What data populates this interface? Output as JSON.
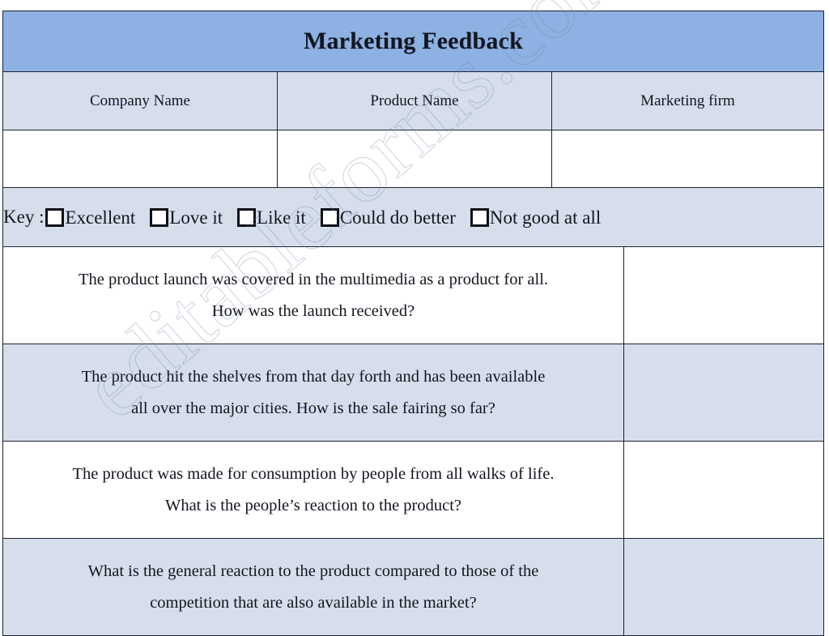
{
  "document": {
    "title": "Marketing Feedback",
    "watermark": "editableforms.com"
  },
  "colors": {
    "title_bar": "#8db1e3",
    "shaded_row": "#d6deec",
    "plain_row": "#ffffff",
    "border": "#1c2230",
    "text": "#12161f"
  },
  "info_table": {
    "headers": [
      "Company Name",
      "Product Name",
      "Marketing firm"
    ],
    "values": [
      "",
      "",
      ""
    ]
  },
  "key": {
    "label": "Key :",
    "options": [
      {
        "label": "Excellent",
        "checked": false
      },
      {
        "label": "Love it",
        "checked": false
      },
      {
        "label": "Like it",
        "checked": false
      },
      {
        "label": "Could do better",
        "checked": false
      },
      {
        "label": "Not good at all",
        "checked": false
      }
    ]
  },
  "questions": [
    {
      "line1": "The product launch was covered in the multimedia as a product for all.",
      "line2": "How was the launch received?",
      "answer": "",
      "shaded": false
    },
    {
      "line1": "The product hit the shelves from that day forth and has been available",
      "line2": "all over the major cities. How is the sale fairing so far?",
      "answer": "",
      "shaded": true
    },
    {
      "line1": "The product was made for consumption by people from all walks of life.",
      "line2": "What is the people’s reaction to the product?",
      "answer": "",
      "shaded": false
    },
    {
      "line1": "What is the general reaction to the product compared to those of the",
      "line2": "competition that are also available in the market?",
      "answer": "",
      "shaded": true
    }
  ]
}
